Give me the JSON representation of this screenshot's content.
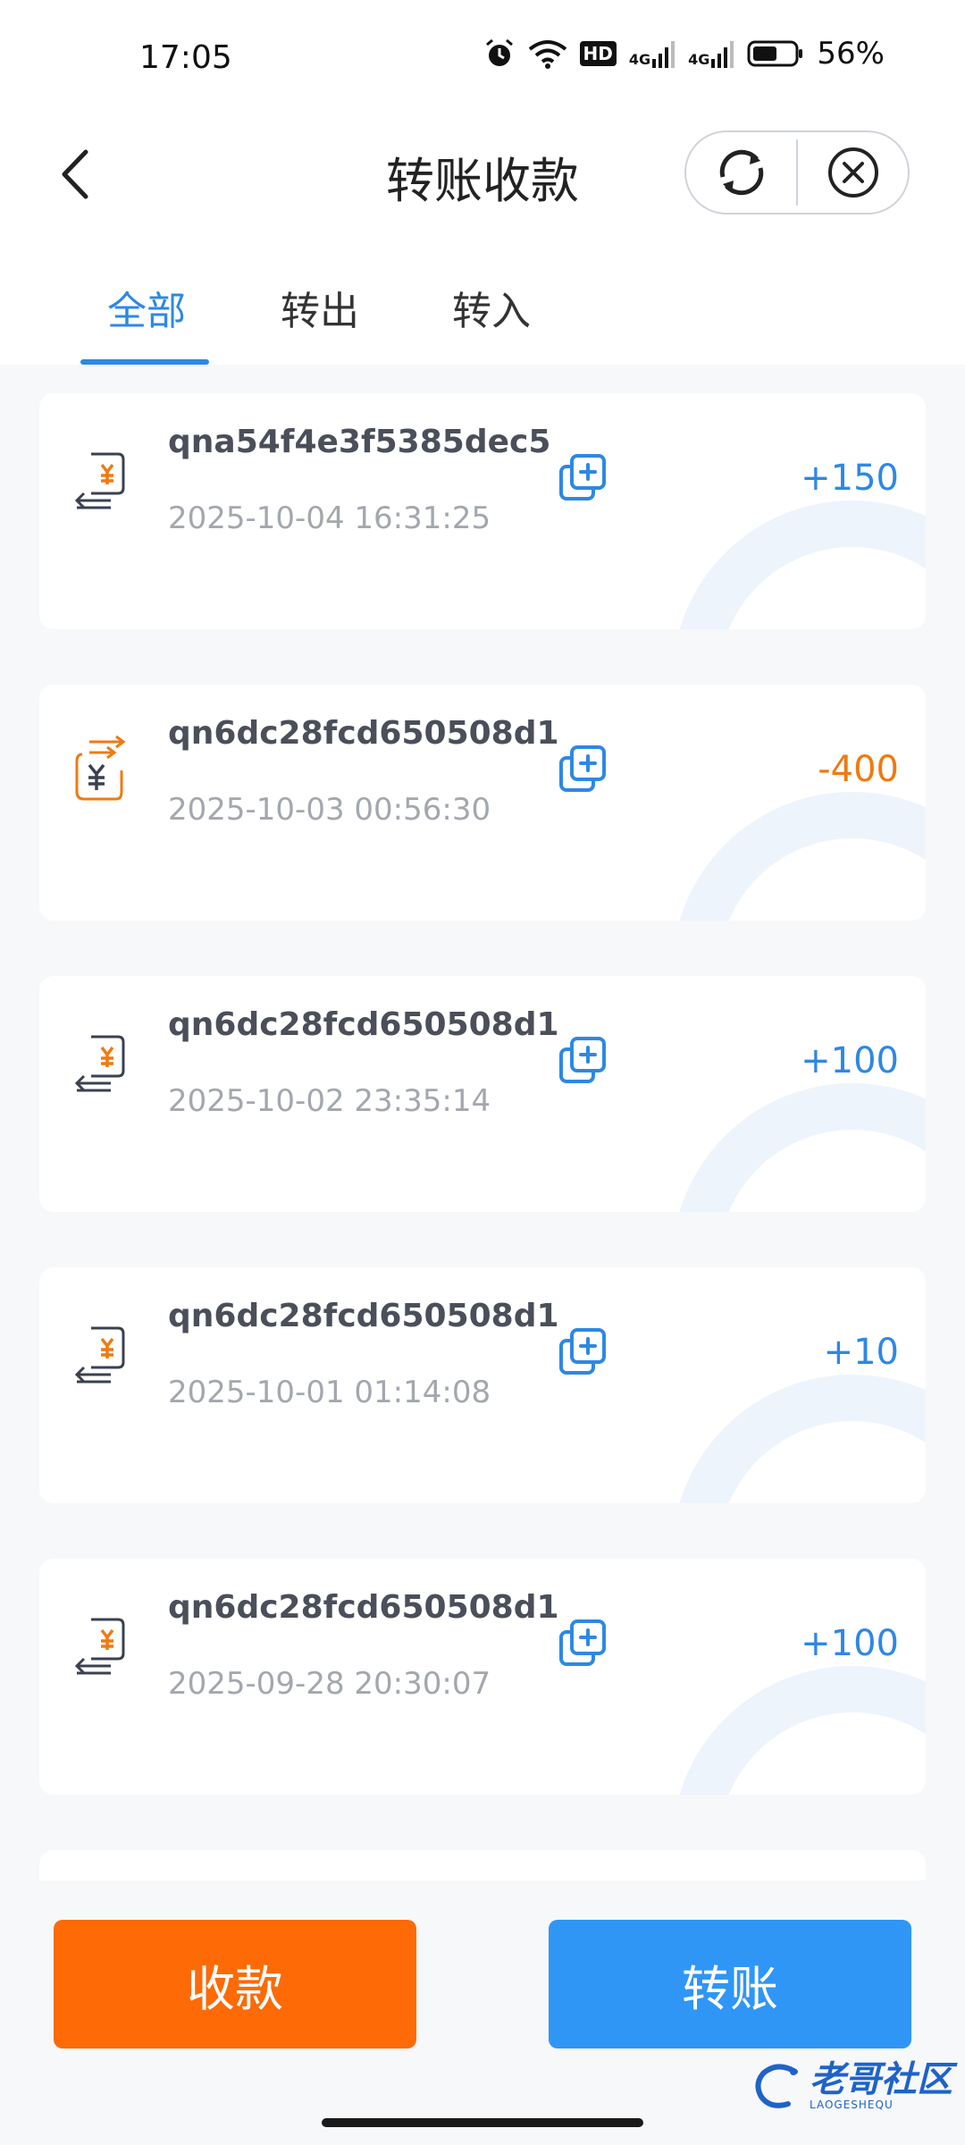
{
  "status_bar": {
    "time": "17:05",
    "battery": "56%",
    "hd_badge": "HD",
    "net_a": "4G",
    "net_b": "4G",
    "icons": [
      "alarm-icon",
      "wifi-icon",
      "hd-icon",
      "signal-4g-icon",
      "signal-4g-icon",
      "battery-icon"
    ]
  },
  "header": {
    "title": "转账收款",
    "back_icon": "chevron-left-icon",
    "refresh_icon": "refresh-icon",
    "close_icon": "close-circle-icon"
  },
  "tabs": [
    {
      "label": "全部",
      "active": true
    },
    {
      "label": "转出",
      "active": false
    },
    {
      "label": "转入",
      "active": false
    }
  ],
  "transactions": [
    {
      "id": "qna54f4e3f5385dec5",
      "date": "2025-10-04 16:31:25",
      "amount": "+150",
      "direction": "in"
    },
    {
      "id": "qn6dc28fcd650508d1",
      "date": "2025-10-03 00:56:30",
      "amount": "-400",
      "direction": "out"
    },
    {
      "id": "qn6dc28fcd650508d1",
      "date": "2025-10-02 23:35:14",
      "amount": "+100",
      "direction": "in"
    },
    {
      "id": "qn6dc28fcd650508d1",
      "date": "2025-10-01 01:14:08",
      "amount": "+10",
      "direction": "in"
    },
    {
      "id": "qn6dc28fcd650508d1",
      "date": "2025-09-28 20:30:07",
      "amount": "+100",
      "direction": "in"
    }
  ],
  "actions": {
    "receive_label": "收款",
    "transfer_label": "转账"
  },
  "watermark": {
    "text": "老哥社区",
    "subtext": "LAOGESHEQU"
  },
  "colors": {
    "accent_blue": "#2e88e3",
    "amount_out": "#f07a10",
    "receive_button": "#fd6a06",
    "transfer_button": "#2f96f6"
  }
}
